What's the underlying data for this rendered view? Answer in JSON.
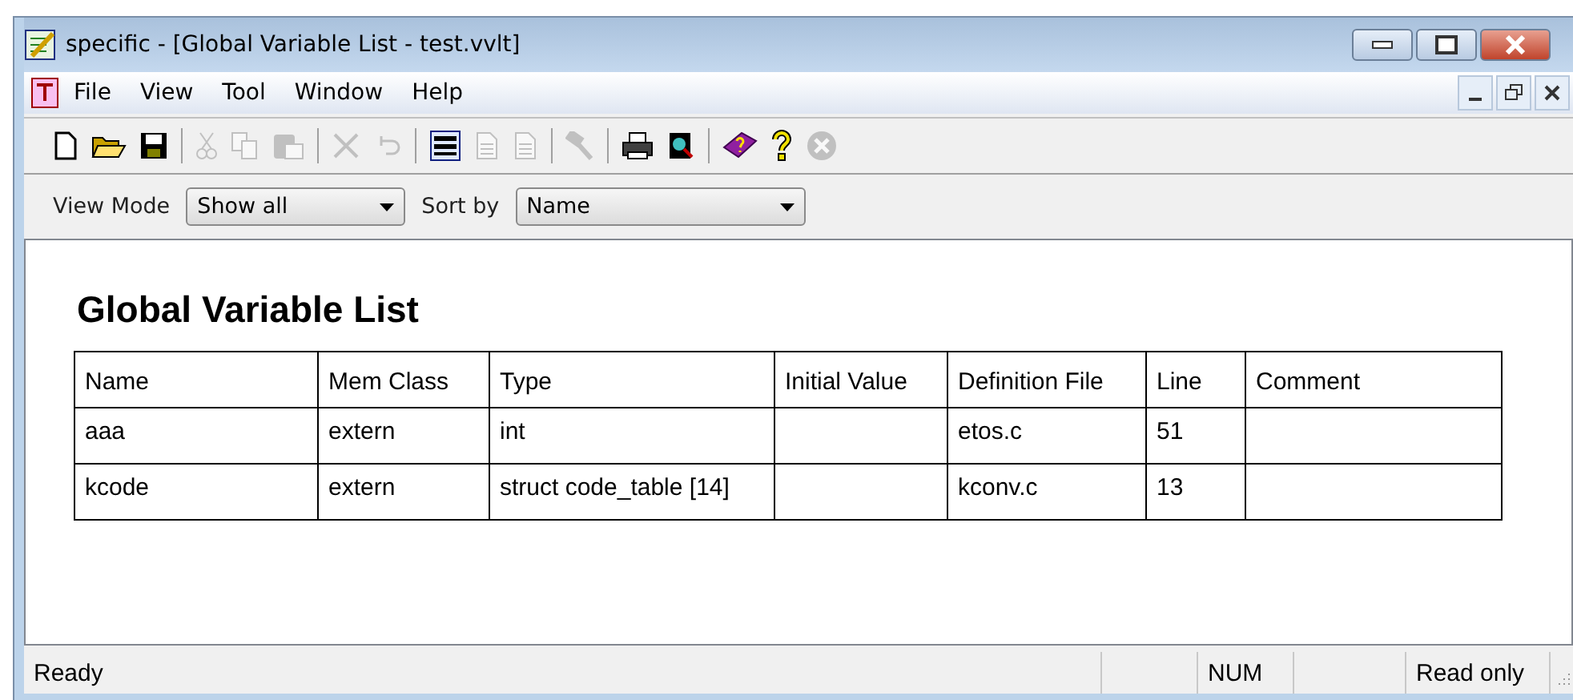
{
  "window": {
    "title": "specific - [Global Variable List - test.vvlt]"
  },
  "menu": [
    "File",
    "View",
    "Tool",
    "Window",
    "Help"
  ],
  "toolbar": [
    {
      "kind": "new",
      "disabled": false
    },
    {
      "kind": "open",
      "disabled": false
    },
    {
      "kind": "save",
      "disabled": false
    },
    {
      "kind": "sep"
    },
    {
      "kind": "cut",
      "disabled": true
    },
    {
      "kind": "copy",
      "disabled": true
    },
    {
      "kind": "paste",
      "disabled": true
    },
    {
      "kind": "sep"
    },
    {
      "kind": "delete",
      "disabled": true
    },
    {
      "kind": "undo",
      "disabled": true
    },
    {
      "kind": "sep"
    },
    {
      "kind": "window",
      "disabled": false
    },
    {
      "kind": "page",
      "disabled": true
    },
    {
      "kind": "page",
      "disabled": true
    },
    {
      "kind": "sep"
    },
    {
      "kind": "hammer",
      "disabled": true
    },
    {
      "kind": "sep"
    },
    {
      "kind": "print",
      "disabled": false
    },
    {
      "kind": "preview",
      "disabled": false
    },
    {
      "kind": "sep"
    },
    {
      "kind": "book",
      "disabled": false
    },
    {
      "kind": "help",
      "disabled": false
    },
    {
      "kind": "stop",
      "disabled": true
    }
  ],
  "filters": [
    {
      "label": "View Mode",
      "value": "Show all"
    },
    {
      "label": "Sort by",
      "value": "Name"
    }
  ],
  "heading": "Global Variable List",
  "table": {
    "columns": [
      "Name",
      "Mem Class",
      "Type",
      "Initial Value",
      "Definition File",
      "Line",
      "Comment"
    ],
    "rows": [
      [
        "aaa",
        "extern",
        "int",
        "",
        "etos.c",
        "51",
        ""
      ],
      [
        "kcode",
        "extern",
        "struct code_table [14]",
        "",
        "kconv.c",
        "13",
        ""
      ]
    ]
  },
  "status_bar": [
    "Ready",
    "NUM",
    "Read only"
  ]
}
